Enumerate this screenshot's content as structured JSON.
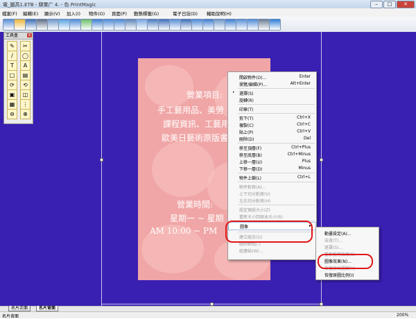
{
  "window": {
    "title": "電_圖高1.ETB - 驛業广 4. - 色 PrintMagic",
    "buttons": [
      "–",
      "□",
      "✕"
    ]
  },
  "menu": [
    "檔案(F)",
    "編輯(E)",
    "顯示(V)",
    "加入(I)",
    "物件(O)",
    "頁面(P)",
    "動態標籤(G)",
    "電子日誌(D)",
    "輔助說明(H)"
  ],
  "toolbar_icons": [
    "new-icon",
    "open-icon",
    "save-icon",
    "print-icon",
    "preview-icon",
    "image-icon",
    "scan-icon",
    "fill-icon",
    "eject-icon",
    "undo-icon",
    "redo-icon",
    "zoom-out-icon",
    "zoom-icon",
    "crop-icon",
    "tile-icon",
    "layout-icon",
    "picture-icon",
    "photo-icon",
    "bag-icon",
    "email-icon",
    "wizard-icon",
    "calendar-icon",
    "help-icon",
    "hd-icon",
    "play-icon"
  ],
  "toolbox": {
    "title": "工具盒",
    "tools": [
      "✎",
      "✂",
      "/",
      "◯",
      "T",
      "A",
      "□",
      "▤",
      "⟳",
      "⟲",
      "▣",
      "◫",
      "▦",
      "⋮",
      "⊖",
      "⊕"
    ]
  },
  "page": {
    "heading": "營業項目:",
    "lines": [
      "手工藝用品、美勞",
      "課程資訊、工藝用",
      "歐美日藝術原版書"
    ],
    "hours_heading": "營業時間:",
    "hours_days": "星期一 ~ 星期",
    "hours_time": "AM 10:00 ~ PM"
  },
  "context_menu": {
    "items": [
      {
        "label": "開啟物件(O)...",
        "shortcut": "Enter",
        "disabled": false
      },
      {
        "label": "瀏覽/編輯(P)...",
        "shortcut": "Alt+Enter",
        "disabled": false
      },
      {
        "sep": true
      },
      {
        "label": "選擇(S)",
        "shortcut": "",
        "disabled": false,
        "check": "•"
      },
      {
        "label": "旋轉(R)",
        "shortcut": "",
        "disabled": false
      },
      {
        "sep": true
      },
      {
        "label": "印章(T)",
        "shortcut": "",
        "disabled": false
      },
      {
        "sep": true
      },
      {
        "label": "剪下(T)",
        "shortcut": "Ctrl+X",
        "disabled": false
      },
      {
        "label": "複製(C)",
        "shortcut": "Ctrl+C",
        "disabled": false
      },
      {
        "label": "貼上(P)",
        "shortcut": "Ctrl+V",
        "disabled": false
      },
      {
        "label": "刪除(D)",
        "shortcut": "Del",
        "disabled": false
      },
      {
        "sep": true
      },
      {
        "label": "移至頂層(F)",
        "shortcut": "Ctrl+Plus",
        "disabled": false
      },
      {
        "label": "移至底層(B)",
        "shortcut": "Ctrl+Minus",
        "disabled": false
      },
      {
        "label": "上移一層(U)",
        "shortcut": "Plus",
        "disabled": false
      },
      {
        "label": "下移一層(D)",
        "shortcut": "Minus",
        "disabled": false
      },
      {
        "sep": true
      },
      {
        "label": "物件上鎖(L)",
        "shortcut": "Ctrl+L",
        "disabled": false
      },
      {
        "sep": true
      },
      {
        "label": "物件對齊(A)...",
        "shortcut": "",
        "disabled": true
      },
      {
        "label": "上下均分對齊(V)",
        "shortcut": "",
        "disabled": true
      },
      {
        "label": "左右均分對齊(H)",
        "shortcut": "",
        "disabled": true
      },
      {
        "sep": true
      },
      {
        "label": "設定預設大小(Z)",
        "shortcut": "",
        "disabled": true
      },
      {
        "label": "重新大小回原本大小(R)",
        "shortcut": "",
        "disabled": true
      },
      {
        "sep": true
      },
      {
        "label": "圖像",
        "shortcut": "",
        "disabled": false,
        "submenu": true,
        "highlight": true
      },
      {
        "sep": true
      },
      {
        "label": "建立組合(G)",
        "shortcut": "",
        "disabled": true
      },
      {
        "label": "刪除群組(-)",
        "shortcut": "",
        "disabled": true
      },
      {
        "label": "組連結(W)...",
        "shortcut": "",
        "disabled": true
      }
    ]
  },
  "submenu": {
    "items": [
      {
        "label": "動畫設定(A)...",
        "disabled": false
      },
      {
        "label": "去背(T)...",
        "disabled": true
      },
      {
        "label": "遮罩(S)...",
        "disabled": true
      },
      {
        "label": "重新套用效果(E)",
        "disabled": true
      },
      {
        "label": "圖像效果(N)...",
        "disabled": false
      },
      {
        "label": "恢復原始圖案(Y)",
        "disabled": true
      },
      {
        "label": "恢復原圖比例(I)",
        "disabled": false
      }
    ]
  },
  "tabs": [
    "名片正面",
    "名片背面"
  ],
  "status": {
    "left": "名片背面",
    "zoom": "200%"
  },
  "colors": {
    "canvas": "#3a1fb3",
    "highlight_ring": "#e21515",
    "page": "#f0a6a6"
  }
}
